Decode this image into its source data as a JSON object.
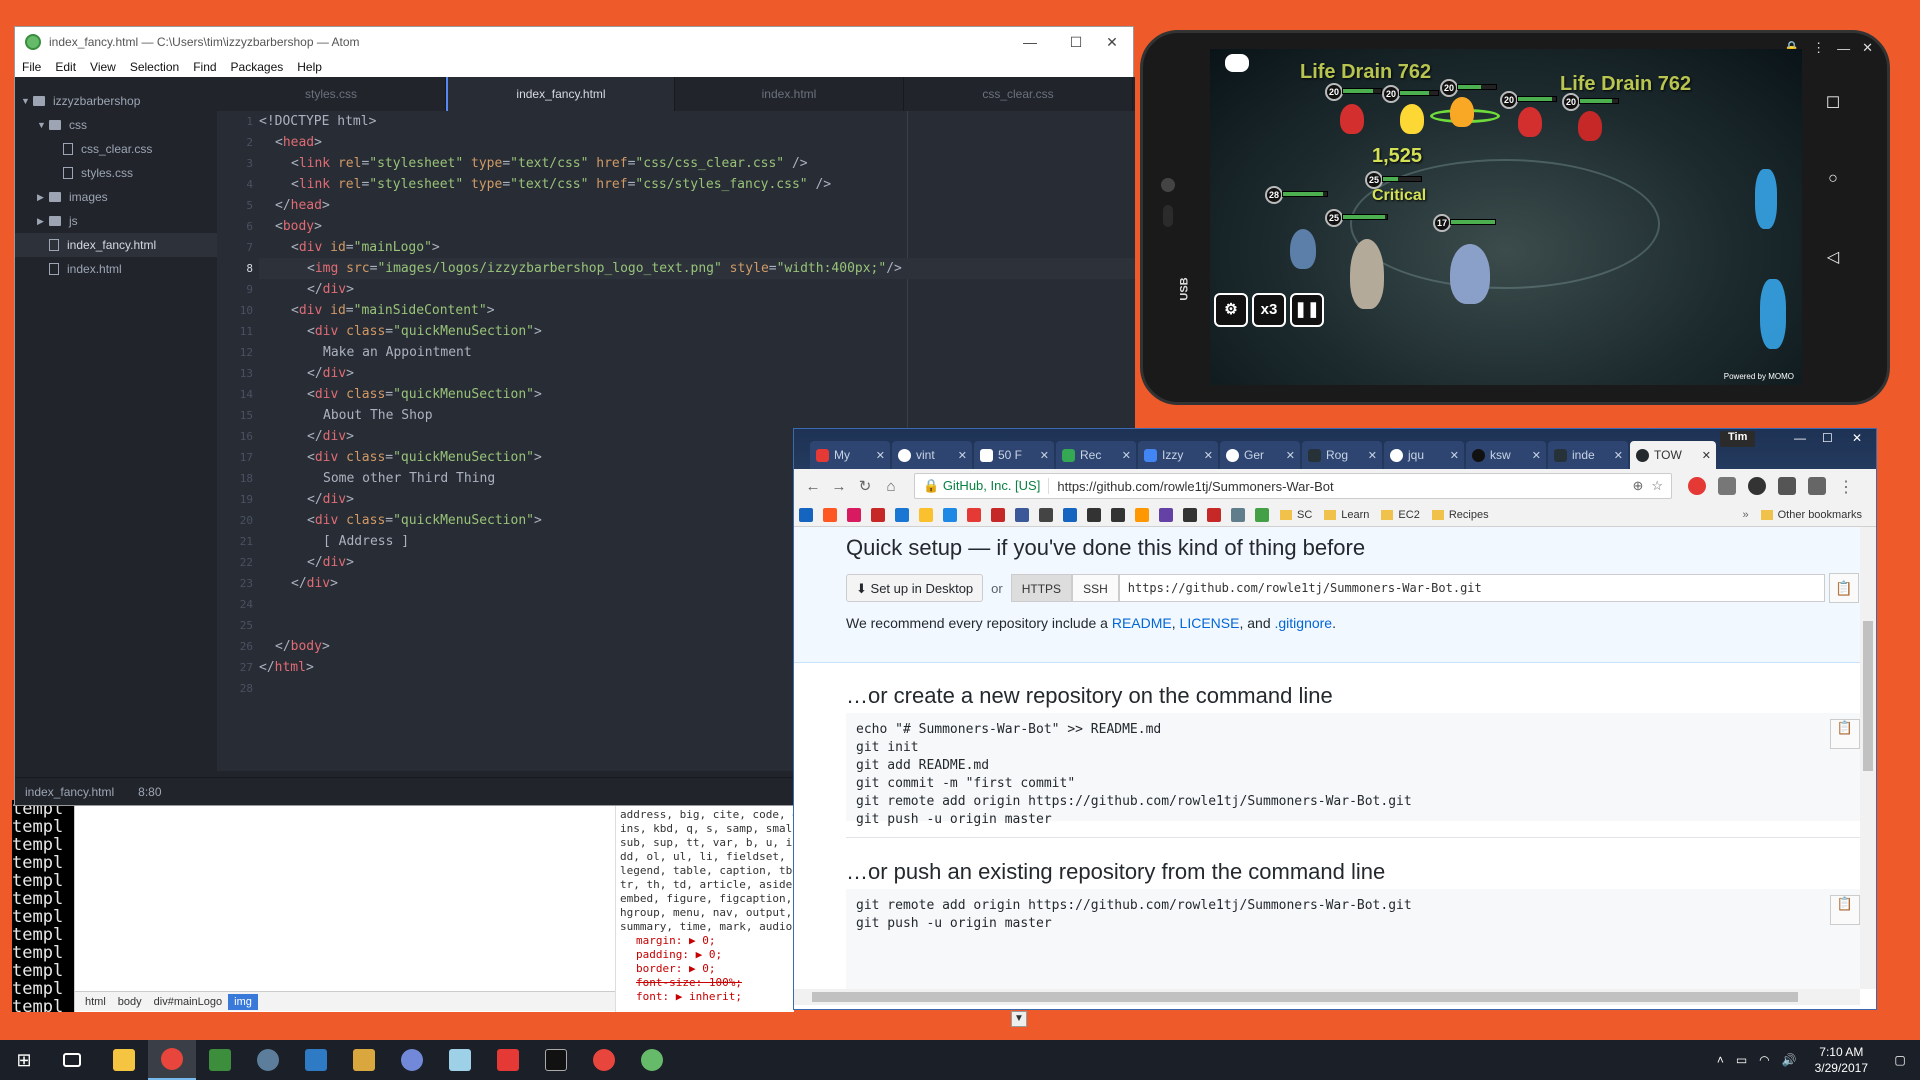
{
  "terminal": {
    "lines": [
      "templ",
      "templ",
      "templ",
      "templ",
      "templ",
      "templ",
      "templ",
      "templ",
      "templ",
      "templ",
      "templ",
      "templ"
    ]
  },
  "devtools": {
    "css_lines": [
      "address, big, cite, code, d",
      "ins, kbd, q, s, samp, small",
      "sub, sup, tt, var, b, u, i,",
      "dd, ol, ul, li, fieldset, f",
      "legend, table, caption, tbo",
      "tr, th, td, article, aside,",
      "embed, figure, figcaption,",
      "hgroup, menu, nav, output,",
      "summary, time, mark, audio,"
    ],
    "props": [
      "margin: ▶ 0;",
      "padding: ▶ 0;",
      "border: ▶ 0;",
      "font-size: 100%;",
      "font: ▶ inherit;"
    ],
    "breadcrumb": [
      "html",
      "body",
      "div#mainLogo",
      "img"
    ]
  },
  "atom": {
    "title": "index_fancy.html — C:\\Users\\tim\\izzyzbarbershop — Atom",
    "menu": [
      "File",
      "Edit",
      "View",
      "Selection",
      "Find",
      "Packages",
      "Help"
    ],
    "tree": {
      "project": "izzyzbarbershop",
      "css_folder": "css",
      "css_files": [
        "css_clear.css",
        "styles.css"
      ],
      "images_folder": "images",
      "js_folder": "js",
      "root_files": [
        "index_fancy.html",
        "index.html"
      ]
    },
    "tabs": [
      "styles.css",
      "index_fancy.html",
      "index.html",
      "css_clear.css"
    ],
    "status": {
      "file": "index_fancy.html",
      "cursor": "8:80"
    },
    "line_numbers": [
      "1",
      "2",
      "3",
      "4",
      "5",
      "6",
      "7",
      "8",
      "9",
      "10",
      "11",
      "12",
      "13",
      "14",
      "15",
      "16",
      "17",
      "18",
      "19",
      "20",
      "21",
      "22",
      "23",
      "24",
      "25",
      "26",
      "27",
      "28"
    ],
    "text": {
      "doctype": "<!DOCTYPE html>",
      "head": "head",
      "link1_href": "\"css/css_clear.css\"",
      "link2_href": "\"css/styles_fancy.css\"",
      "body": "body",
      "mainlogo": "\"mainLogo\"",
      "img_src": "\"images/logos/izzyzbarbershop_logo_text.png\"",
      "img_style": "\"width:400px;\"",
      "mainside": "\"mainSideContent\"",
      "qms": "\"quickMenuSection\"",
      "item1": "Make an Appointment",
      "item2": "About The Shop",
      "item3": "Some other Third Thing",
      "item4": "[ Address ]"
    }
  },
  "emulator": {
    "damage": "1,525",
    "critical": "Critical",
    "skill_text": "Life Drain 762",
    "levels": [
      "20",
      "20",
      "20",
      "20",
      "20",
      "25",
      "28",
      "25",
      "17"
    ],
    "usb": "USB",
    "speed": "x3",
    "powered": "Powered by MOMO"
  },
  "chrome": {
    "user": "Tim",
    "tabs": [
      "My",
      "vint",
      "50 F",
      "Rec",
      "Izzy",
      "Ger",
      "Rog",
      "jqu",
      "ksw",
      "inde",
      "TOW"
    ],
    "secure_label": "GitHub, Inc. [US]",
    "url": "https://github.com/rowle1tj/Summoners-War-Bot",
    "bookmarks": [
      "SC",
      "Learn",
      "EC2",
      "Recipes"
    ],
    "other_bookmarks": "Other bookmarks",
    "quick_setup_title": "Quick setup — if you've done this kind of thing before",
    "setup_desktop": "Set up in Desktop",
    "or": "or",
    "https": "HTTPS",
    "ssh": "SSH",
    "clone_url": "https://github.com/rowle1tj/Summoners-War-Bot.git",
    "recommend_prefix": "We recommend every repository include a",
    "readme": "README",
    "license": "LICENSE",
    "and": ", and",
    "gitignore": ".gitignore",
    "new_repo_title": "…or create a new repository on the command line",
    "new_repo_cmds": [
      "echo \"# Summoners-War-Bot\" >> README.md",
      "git init",
      "git add README.md",
      "git commit -m \"first commit\"",
      "git remote add origin https://github.com/rowle1tj/Summoners-War-Bot.git",
      "git push -u origin master"
    ],
    "push_title": "…or push an existing repository from the command line",
    "push_cmds": [
      "git remote add origin https://github.com/rowle1tj/Summoners-War-Bot.git",
      "git push -u origin master"
    ]
  },
  "taskbar": {
    "time": "7:10 AM",
    "date": "3/29/2017"
  }
}
